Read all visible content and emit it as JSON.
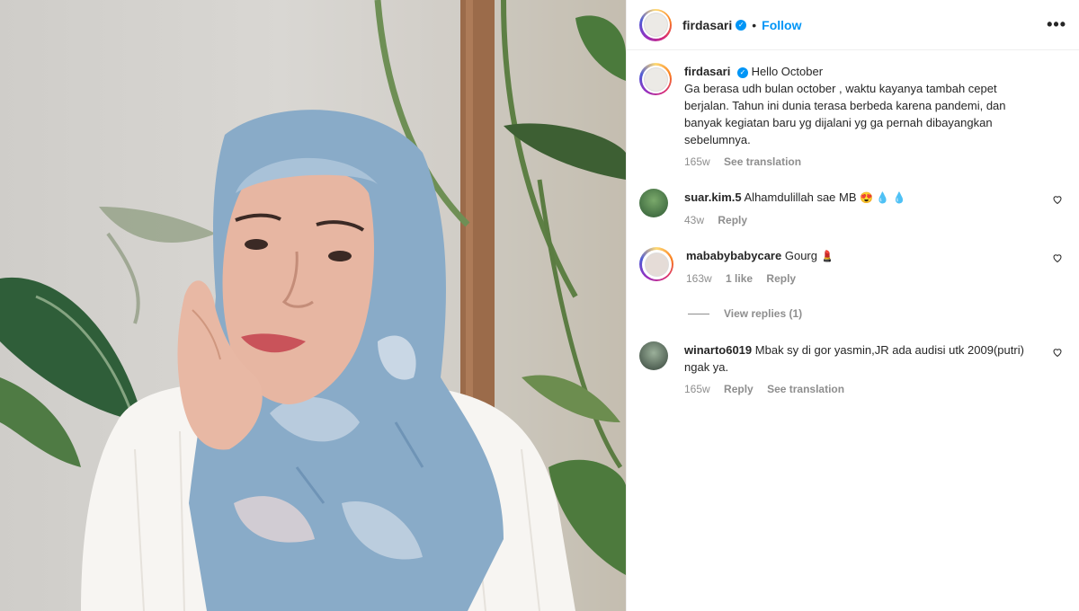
{
  "post": {
    "username": "firdasari",
    "follow_label": "Follow",
    "more_label": "•••"
  },
  "caption": {
    "username": "firdasari",
    "text": "Hello October\nGa berasa udh bulan october , waktu kayanya tambah cepet berjalan. Tahun ini dunia terasa berbeda karena pandemi, dan banyak kegiatan baru yg dijalani yg ga pernah dibayangkan sebelumnya.",
    "age": "165w",
    "translate_label": "See translation"
  },
  "comments": [
    {
      "username": "suar.kim.5",
      "text": "Alhamdulillah sae MB",
      "emoji": "😍 💧 💧",
      "age": "43w",
      "reply_label": "Reply"
    },
    {
      "username": "mababybabycare",
      "text": "Gourg",
      "emoji": "💄",
      "age": "163w",
      "likes": "1 like",
      "reply_label": "Reply",
      "view_replies": "View replies (1)"
    },
    {
      "username": "winarto6019",
      "text": "Mbak sy di gor yasmin,JR ada audisi utk 2009(putri) ngak ya.",
      "age": "165w",
      "reply_label": "Reply",
      "translate_label": "See translation"
    }
  ],
  "colors": {
    "link": "#0095f6",
    "muted": "#8e8e8e",
    "verified": "#0095f6"
  }
}
